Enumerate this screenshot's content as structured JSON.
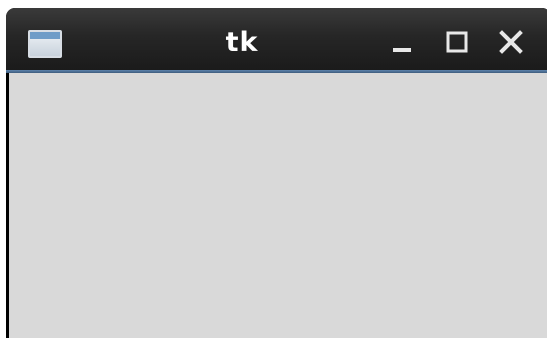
{
  "window": {
    "title": "tk",
    "icons": {
      "app": "window-app-icon",
      "minimize": "minimize-icon",
      "maximize": "maximize-icon",
      "close": "close-icon"
    }
  },
  "colors": {
    "titlebar": "#262626",
    "title_text": "#ffffff",
    "accent_line": "#4f739a",
    "client_background": "#d9d9d9"
  }
}
